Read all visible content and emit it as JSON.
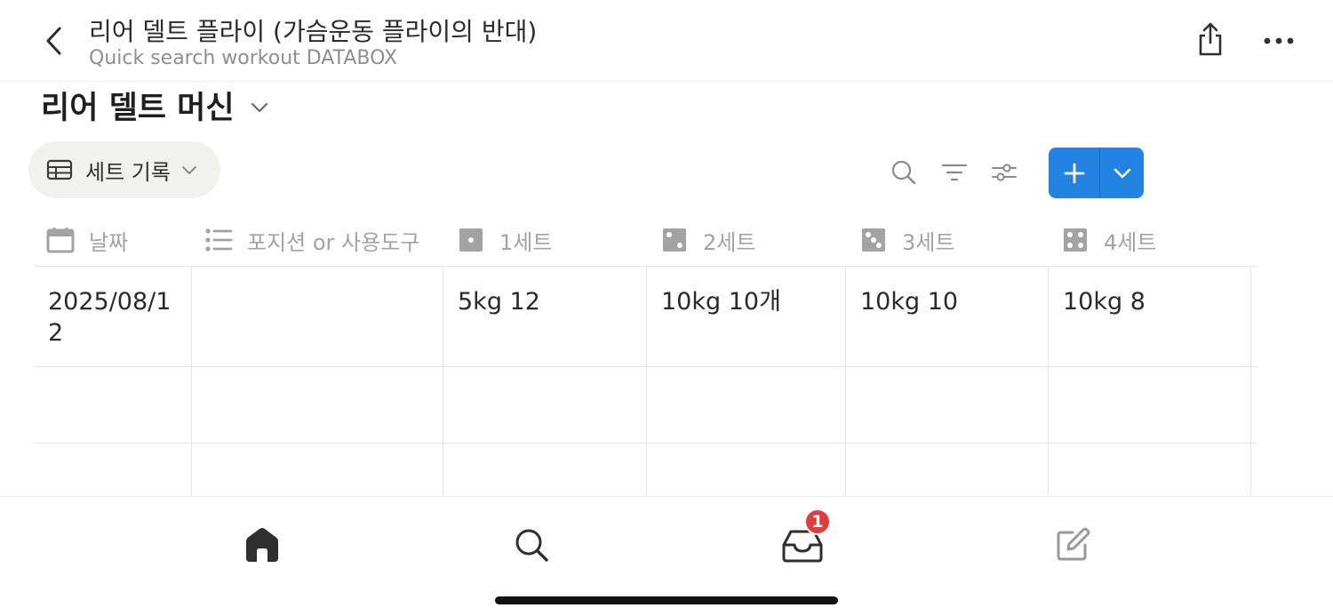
{
  "header": {
    "title": "리어 델트 플라이 (가슴운동 플라이의 반대)",
    "subtitle": "Quick search workout DATABOX"
  },
  "database": {
    "title": "리어 델트 머신",
    "view_label": "세트 기록"
  },
  "table": {
    "columns": [
      {
        "label": "날짜",
        "icon": "calendar-icon"
      },
      {
        "label": "포지션 or 사용도구",
        "icon": "list-icon"
      },
      {
        "label": "1세트",
        "icon": "dice-one-icon"
      },
      {
        "label": "2세트",
        "icon": "dice-two-icon"
      },
      {
        "label": "3세트",
        "icon": "dice-three-icon"
      },
      {
        "label": "4세트",
        "icon": "dice-four-icon"
      }
    ],
    "rows": [
      [
        "2025/08/12",
        "",
        "5kg 12",
        "10kg 10개",
        "10kg 10",
        "10kg 8"
      ],
      [
        "",
        "",
        "",
        "",
        "",
        ""
      ],
      [
        "",
        "",
        "",
        "",
        "",
        ""
      ]
    ]
  },
  "bottom_nav": {
    "items": [
      "home-icon",
      "search-icon",
      "inbox-icon",
      "edit-icon"
    ],
    "inbox_badge": "1"
  },
  "colors": {
    "accent": "#2383e2",
    "badge": "#e03e3e"
  }
}
